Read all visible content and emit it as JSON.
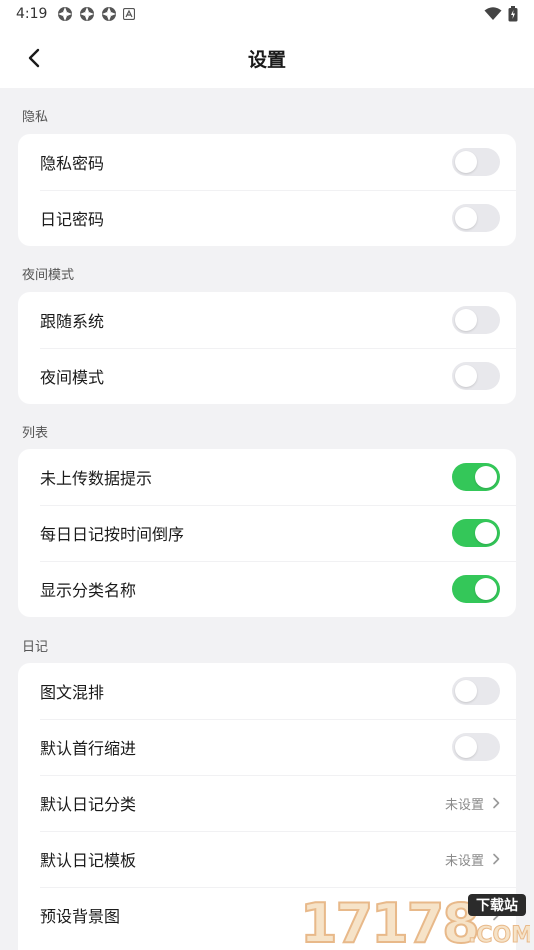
{
  "status": {
    "time": "4:19"
  },
  "appbar": {
    "title": "设置"
  },
  "sections": [
    {
      "title": "隐私",
      "rows": [
        {
          "label": "隐私密码",
          "type": "switch",
          "on": false
        },
        {
          "label": "日记密码",
          "type": "switch",
          "on": false
        }
      ]
    },
    {
      "title": "夜间模式",
      "rows": [
        {
          "label": "跟随系统",
          "type": "switch",
          "on": false
        },
        {
          "label": "夜间模式",
          "type": "switch",
          "on": false
        }
      ]
    },
    {
      "title": "列表",
      "rows": [
        {
          "label": "未上传数据提示",
          "type": "switch",
          "on": true
        },
        {
          "label": "每日日记按时间倒序",
          "type": "switch",
          "on": true
        },
        {
          "label": "显示分类名称",
          "type": "switch",
          "on": true
        }
      ]
    },
    {
      "title": "日记",
      "rows": [
        {
          "label": "图文混排",
          "type": "switch",
          "on": false
        },
        {
          "label": "默认首行缩进",
          "type": "switch",
          "on": false
        },
        {
          "label": "默认日记分类",
          "type": "link",
          "value": "未设置"
        },
        {
          "label": "默认日记模板",
          "type": "link",
          "value": "未设置"
        },
        {
          "label": "预设背景图",
          "type": "link",
          "value": ""
        }
      ]
    }
  ],
  "watermark": {
    "text": "17178",
    "badge": "下载站",
    "suffix": ".COM"
  },
  "colors": {
    "switch_on": "#34c759",
    "switch_off": "#e8e8ec",
    "background": "#f2f2f4"
  }
}
